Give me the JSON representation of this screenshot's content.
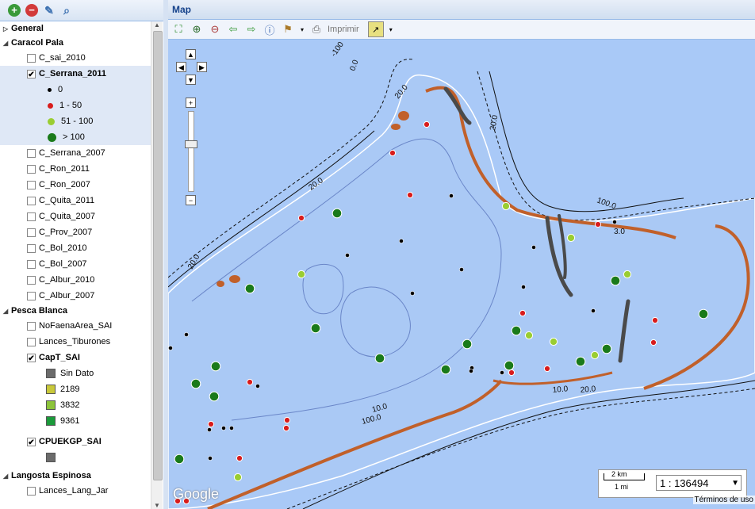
{
  "left_toolbar": {
    "add_icon": "add-layer-icon",
    "remove_icon": "remove-layer-icon",
    "tool_icon": "wrench-icon",
    "zoom_icon": "magnifier-icon"
  },
  "groups": [
    {
      "label": "General"
    },
    {
      "label": "Caracol Pala"
    },
    {
      "label": "Pesca Blanca"
    },
    {
      "label": "Langosta Espinosa"
    }
  ],
  "caracol_layers": {
    "c_sai_2010": "C_sai_2010",
    "c_serrana_2011": "C_Serrana_2011",
    "legend": [
      "0",
      "1 - 50",
      "51 - 100",
      "> 100"
    ],
    "rest": [
      "C_Serrana_2007",
      "C_Ron_2011",
      "C_Ron_2007",
      "C_Quita_2011",
      "C_Quita_2007",
      "C_Prov_2007",
      "C_Bol_2010",
      "C_Bol_2007",
      "C_Albur_2010",
      "C_Albur_2007"
    ]
  },
  "pesca_layers": {
    "nofaena": "NoFaenaArea_SAI",
    "lances": "Lances_Tiburones",
    "capt": "CapT_SAI",
    "capt_legend": [
      "Sin Dato",
      "2189",
      "3832",
      "9361"
    ],
    "cpue": "CPUEKGP_SAI"
  },
  "langosta_layers": {
    "lances_lang": "Lances_Lang_Jar"
  },
  "map": {
    "title": "Map",
    "print_label": "Imprimir",
    "scale_km": "2 km",
    "scale_mi": "1 mi",
    "zoom_value": "1 : 136494",
    "terms": "Términos de uso",
    "logo": "Google",
    "contours": [
      "-100",
      "0.0",
      "20.0",
      "20.0",
      "20.0",
      "20.0",
      "100.0",
      "10.0",
      "20.0",
      "10.0",
      "100.0",
      "3.0"
    ]
  },
  "colors": {
    "zero": "#000000",
    "low": "#d81c1c",
    "mid": "#9acd32",
    "high": "#1a7a1a",
    "water": "#a9c9f7",
    "reef": "#c1602a",
    "cay": "#4a4a4a"
  }
}
